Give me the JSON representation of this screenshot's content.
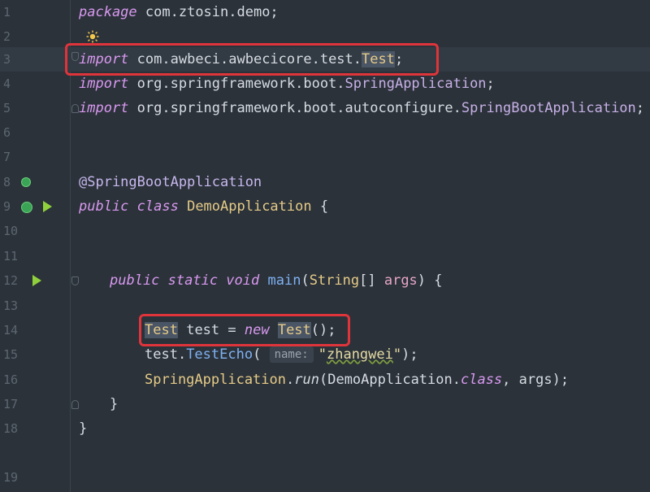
{
  "editor": {
    "line_numbers": [
      "1",
      "2",
      "3",
      "4",
      "5",
      "6",
      "7",
      "8",
      "9",
      "10",
      "11",
      "12",
      "13",
      "14",
      "15",
      "16",
      "17",
      "18",
      "19"
    ],
    "line1": {
      "kw": "package",
      "rest": "com.ztosin.demo;"
    },
    "line3": {
      "kw": "import",
      "pkg": "com.awbeci.awbecicore.test.",
      "cls": "Test",
      "semi": ";"
    },
    "line4": {
      "kw": "import",
      "pkg": "org.springframework.boot.",
      "cls": "SpringApplication",
      "semi": ";"
    },
    "line5": {
      "kw": "import",
      "pkg": "org.springframework.boot.autoconfigure.",
      "cls": "SpringBootApplication",
      "semi": ";"
    },
    "line8": {
      "anno": "@SpringBootApplication"
    },
    "line9": {
      "kw": "public class",
      "cls": "DemoApplication",
      "brace": "{"
    },
    "line12": {
      "kw": "public static void",
      "fn": "main",
      "open": "(",
      "type": "String",
      "arr": "[]",
      "arg": "args",
      "close": ") {"
    },
    "line14": {
      "type": "Test",
      "var": "test = ",
      "kw": "new",
      "cls": "Test",
      "end": "();"
    },
    "line15": {
      "obj": "test.",
      "fn": "TestEcho",
      "open": "(",
      "hint": "name:",
      "str_open": "\"",
      "str_body": "zhangwei",
      "str_close": "\"",
      "end": ");"
    },
    "line16": {
      "cls": "SpringApplication",
      "dot": ".",
      "fn": "run",
      "open": "(",
      "arg1": "DemoApplication.",
      "kw": "class",
      "rest": ", args);"
    },
    "line17": {
      "brace": "}"
    },
    "line19": {
      "brace": "}"
    }
  },
  "colors": {
    "background": "#2b323a",
    "keyword": "#d999f0",
    "class_name": "#e6cb87",
    "annotation_box": "#e0343b",
    "run_icon": "#8fd03c"
  },
  "icons": {
    "intention_bulb": "lightbulb-icon",
    "run_gutter": "run-icon",
    "spring_bean": "spring-bean-icon"
  }
}
